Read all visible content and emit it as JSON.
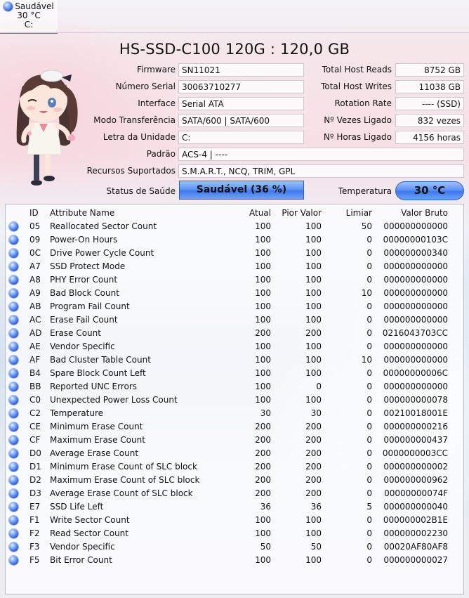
{
  "drive_tab": {
    "status": "Saudável",
    "temperature": "30 °C",
    "letter": "C:"
  },
  "title": "HS-SSD-C100 120G : 120,0 GB",
  "info": {
    "firmware_label": "Firmware",
    "firmware": "SN11021",
    "serial_label": "Número Serial",
    "serial": "30063710277",
    "interface_label": "Interface",
    "interface": "Serial ATA",
    "transfer_label": "Modo Transferência",
    "transfer": "SATA/600 | SATA/600",
    "drive_letter_label": "Letra da Unidade",
    "drive_letter": "C:",
    "standard_label": "Padrão",
    "standard": "ACS-4 | ----",
    "features_label": "Recursos Suportados",
    "features": "S.M.A.R.T., NCQ, TRIM, GPL",
    "host_reads_label": "Total Host Reads",
    "host_reads": "8752 GB",
    "host_writes_label": "Total Host Writes",
    "host_writes": "11038 GB",
    "rotation_label": "Rotation Rate",
    "rotation": "---- (SSD)",
    "power_on_count_label": "Nº Vezes Ligado",
    "power_on_count": "832 vezes",
    "power_on_hours_label": "Nº Horas Ligado",
    "power_on_hours": "4156 horas",
    "health_label": "Status de Saúde",
    "health": "Saudável  (36 %)",
    "temp_label": "Temperatura",
    "temp": "30 °C"
  },
  "table": {
    "headers": {
      "id": "ID",
      "name": "Attribute Name",
      "current": "Atual",
      "worst": "Pior Valor",
      "threshold": "Limiar",
      "raw": "Valor Bruto"
    },
    "rows": [
      {
        "id": "05",
        "name": "Reallocated Sector Count",
        "current": "100",
        "worst": "100",
        "threshold": "50",
        "raw": "000000000000"
      },
      {
        "id": "09",
        "name": "Power-On Hours",
        "current": "100",
        "worst": "100",
        "threshold": "0",
        "raw": "00000000103C"
      },
      {
        "id": "0C",
        "name": "Drive Power Cycle Count",
        "current": "100",
        "worst": "100",
        "threshold": "0",
        "raw": "000000000340"
      },
      {
        "id": "A7",
        "name": "SSD Protect Mode",
        "current": "100",
        "worst": "100",
        "threshold": "0",
        "raw": "000000000000"
      },
      {
        "id": "A8",
        "name": "PHY Error Count",
        "current": "100",
        "worst": "100",
        "threshold": "0",
        "raw": "000000000000"
      },
      {
        "id": "A9",
        "name": "Bad Block Count",
        "current": "100",
        "worst": "100",
        "threshold": "10",
        "raw": "000000000000"
      },
      {
        "id": "AB",
        "name": "Program Fail Count",
        "current": "100",
        "worst": "100",
        "threshold": "0",
        "raw": "000000000000"
      },
      {
        "id": "AC",
        "name": "Erase Fail Count",
        "current": "100",
        "worst": "100",
        "threshold": "0",
        "raw": "000000000000"
      },
      {
        "id": "AD",
        "name": "Erase Count",
        "current": "200",
        "worst": "200",
        "threshold": "0",
        "raw": "0216043703CC"
      },
      {
        "id": "AE",
        "name": "Vendor Specific",
        "current": "100",
        "worst": "100",
        "threshold": "0",
        "raw": "000000000000"
      },
      {
        "id": "AF",
        "name": "Bad Cluster Table Count",
        "current": "100",
        "worst": "100",
        "threshold": "10",
        "raw": "000000000000"
      },
      {
        "id": "B4",
        "name": "Spare Block Count Left",
        "current": "100",
        "worst": "100",
        "threshold": "0",
        "raw": "00000000006C"
      },
      {
        "id": "BB",
        "name": "Reported UNC Errors",
        "current": "100",
        "worst": "0",
        "threshold": "0",
        "raw": "000000000000"
      },
      {
        "id": "C0",
        "name": "Unexpected Power Loss Count",
        "current": "100",
        "worst": "100",
        "threshold": "0",
        "raw": "000000000078"
      },
      {
        "id": "C2",
        "name": "Temperature",
        "current": "30",
        "worst": "30",
        "threshold": "0",
        "raw": "00210018001E"
      },
      {
        "id": "CE",
        "name": "Minimum Erase Count",
        "current": "200",
        "worst": "200",
        "threshold": "0",
        "raw": "000000000216"
      },
      {
        "id": "CF",
        "name": "Maximum Erase Count",
        "current": "200",
        "worst": "200",
        "threshold": "0",
        "raw": "000000000437"
      },
      {
        "id": "D0",
        "name": "Average Erase Count",
        "current": "200",
        "worst": "200",
        "threshold": "0",
        "raw": "0000000003CC"
      },
      {
        "id": "D1",
        "name": "Minimum Erase Count of SLC block",
        "current": "200",
        "worst": "200",
        "threshold": "0",
        "raw": "000000000002"
      },
      {
        "id": "D2",
        "name": "Maximum Erase Count of SLC block",
        "current": "200",
        "worst": "200",
        "threshold": "0",
        "raw": "000000000962"
      },
      {
        "id": "D3",
        "name": "Average Erase Count of SLC block",
        "current": "200",
        "worst": "200",
        "threshold": "0",
        "raw": "00000000074F"
      },
      {
        "id": "E7",
        "name": "SSD Life Left",
        "current": "36",
        "worst": "36",
        "threshold": "5",
        "raw": "000000000040"
      },
      {
        "id": "F1",
        "name": "Write Sector Count",
        "current": "100",
        "worst": "100",
        "threshold": "0",
        "raw": "000000002B1E"
      },
      {
        "id": "F2",
        "name": "Read Sector Count",
        "current": "100",
        "worst": "100",
        "threshold": "0",
        "raw": "000000002230"
      },
      {
        "id": "F3",
        "name": "Vendor Specific",
        "current": "50",
        "worst": "50",
        "threshold": "0",
        "raw": "00020AF80AF8"
      },
      {
        "id": "F5",
        "name": "Bit Error Count",
        "current": "100",
        "worst": "100",
        "threshold": "0",
        "raw": "000000000027"
      }
    ]
  },
  "colors": {
    "status_good": "#3f79ee",
    "tab_underline": "#7a5bc6"
  }
}
